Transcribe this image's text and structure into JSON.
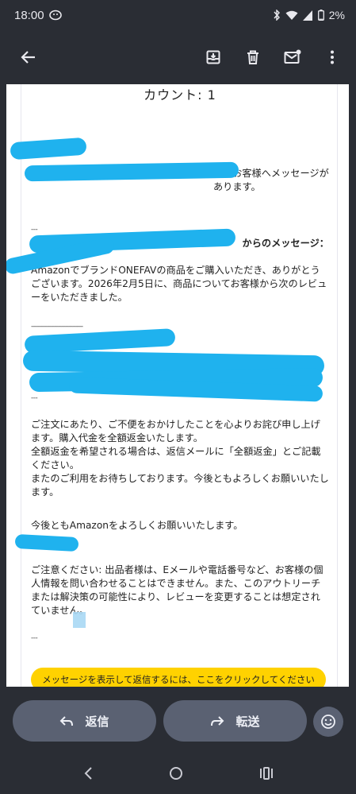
{
  "status_bar": {
    "time": "18:00",
    "battery": "2%",
    "icons": [
      "app-notification-icon",
      "bluetooth-icon",
      "wifi-icon",
      "signal-icon",
      "battery-icon"
    ]
  },
  "app_bar": {
    "icons": [
      "back-arrow-icon",
      "archive-icon",
      "delete-icon",
      "mark-unread-icon",
      "more-vert-icon"
    ]
  },
  "email": {
    "count_line": "カウント: 1",
    "p1": "よりお客様へメッセージがあります。",
    "rule1": "---",
    "p2_heading": "からのメッセージ：",
    "p3": "AmazonでブランドONEFAVの商品をご購入いただき、ありがとうございます。2026年2月5日に、商品についてお客様から次のレビューをいただきました。",
    "rule2": "-----------------------------",
    "rule3": "---",
    "p4": "ご注文にあたり、ご不便をおかけしたことを心よりお詫び申し上げます。購入代金を全額返金いたします。\n全額返金を希望される場合は、返信メールに「全額返金」とご記載ください。\nまたのご利用をお待ちしております。今後ともよろしくお願いいたします。",
    "p5": "今後ともAmazonをよろしくお願いいたします。",
    "p6": "ご注意ください: 出品者様は、Eメールや電話番号など、お客様の個人情報を問い合わせることはできません。また、このアウトリーチまたは解決策の可能性により、レビューを変更することは想定されていません。",
    "rule4": "---",
    "cta": "メッセージを表示して返信するには、ここをクリックしてください"
  },
  "actions": {
    "reply_label": "返信",
    "forward_label": "転送",
    "reply_icon": "reply-icon",
    "forward_icon": "forward-icon",
    "emoji_icon": "emoji-reaction-icon"
  },
  "nav_bar": {
    "icons": [
      "nav-back-icon",
      "nav-home-icon",
      "nav-recents-icon"
    ]
  },
  "colors": {
    "background": "#2a2d34",
    "redaction": "#1fb2ee",
    "cta": "#ffd200",
    "pill": "#5a6172"
  }
}
